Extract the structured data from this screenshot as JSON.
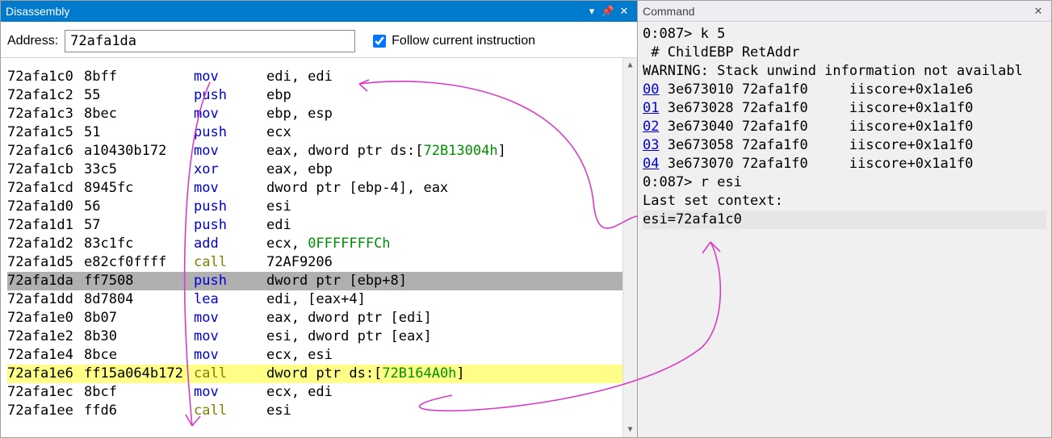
{
  "disasm": {
    "title": "Disassembly",
    "address_label": "Address:",
    "address_value": "72afa1da",
    "follow_label": "Follow current instruction",
    "follow_checked": true,
    "current_index": 8,
    "highlight_index": 17,
    "rows": [
      {
        "addr": "",
        "bytes": "",
        "mn": "",
        "mncls": "blue",
        "ops": "",
        "partial_top": true
      },
      {
        "addr": "72afa1c0",
        "bytes": "8bff",
        "mn": "mov",
        "mncls": "blue",
        "ops": "edi, edi"
      },
      {
        "addr": "72afa1c2",
        "bytes": "55",
        "mn": "push",
        "mncls": "blue",
        "ops": "ebp"
      },
      {
        "addr": "72afa1c3",
        "bytes": "8bec",
        "mn": "mov",
        "mncls": "blue",
        "ops": "ebp, esp"
      },
      {
        "addr": "72afa1c5",
        "bytes": "51",
        "mn": "push",
        "mncls": "blue",
        "ops": "ecx"
      },
      {
        "addr": "72afa1c6",
        "bytes": "a10430b172",
        "mn": "mov",
        "mncls": "blue",
        "ops": "eax, dword ptr ds:[",
        "lit": "72B13004h",
        "ops2": "]"
      },
      {
        "addr": "72afa1cb",
        "bytes": "33c5",
        "mn": "xor",
        "mncls": "blue",
        "ops": "eax, ebp"
      },
      {
        "addr": "72afa1cd",
        "bytes": "8945fc",
        "mn": "mov",
        "mncls": "blue",
        "ops": "dword ptr [ebp-4], eax"
      },
      {
        "addr": "72afa1d0",
        "bytes": "56",
        "mn": "push",
        "mncls": "blue",
        "ops": "esi"
      },
      {
        "addr": "72afa1d1",
        "bytes": "57",
        "mn": "push",
        "mncls": "blue",
        "ops": "edi"
      },
      {
        "addr": "72afa1d2",
        "bytes": "83c1fc",
        "mn": "add",
        "mncls": "blue",
        "ops": "ecx, ",
        "lit": "0FFFFFFFCh"
      },
      {
        "addr": "72afa1d5",
        "bytes": "e82cf0ffff",
        "mn": "call",
        "mncls": "olive",
        "ops": "72AF9206"
      },
      {
        "addr": "72afa1da",
        "bytes": "ff7508",
        "mn": "push",
        "mncls": "blue",
        "ops": "dword ptr [ebp+8]"
      },
      {
        "addr": "72afa1dd",
        "bytes": "8d7804",
        "mn": "lea",
        "mncls": "blue",
        "ops": "edi, [eax+4]"
      },
      {
        "addr": "72afa1e0",
        "bytes": "8b07",
        "mn": "mov",
        "mncls": "blue",
        "ops": "eax, dword ptr [edi]"
      },
      {
        "addr": "72afa1e2",
        "bytes": "8b30",
        "mn": "mov",
        "mncls": "blue",
        "ops": "esi, dword ptr [eax]"
      },
      {
        "addr": "72afa1e4",
        "bytes": "8bce",
        "mn": "mov",
        "mncls": "blue",
        "ops": "ecx, esi"
      },
      {
        "addr": "72afa1e6",
        "bytes": "ff15a064b172",
        "mn": "call",
        "mncls": "olive",
        "ops": "dword ptr ds:[",
        "lit": "72B164A0h",
        "ops2": "]"
      },
      {
        "addr": "72afa1ec",
        "bytes": "8bcf",
        "mn": "mov",
        "mncls": "blue",
        "ops": "ecx, edi"
      },
      {
        "addr": "72afa1ee",
        "bytes": "ffd6",
        "mn": "call",
        "mncls": "olive",
        "ops": "esi"
      }
    ]
  },
  "command": {
    "title": "Command",
    "lines": [
      {
        "t": "prompt",
        "text": "0:087> k 5"
      },
      {
        "t": "plain",
        "text": " # ChildEBP RetAddr"
      },
      {
        "t": "plain",
        "text": "WARNING: Stack unwind information not availabl"
      },
      {
        "t": "frame",
        "link": "00",
        "rest": " 3e673010 72afa1f0     iiscore+0x1a1e6"
      },
      {
        "t": "frame",
        "link": "01",
        "rest": " 3e673028 72afa1f0     iiscore+0x1a1f0"
      },
      {
        "t": "frame",
        "link": "02",
        "rest": " 3e673040 72afa1f0     iiscore+0x1a1f0"
      },
      {
        "t": "frame",
        "link": "03",
        "rest": " 3e673058 72afa1f0     iiscore+0x1a1f0"
      },
      {
        "t": "frame",
        "link": "04",
        "rest": " 3e673070 72afa1f0     iiscore+0x1a1f0"
      },
      {
        "t": "prompt",
        "text": "0:087> r esi"
      },
      {
        "t": "plain",
        "text": "Last set context:"
      },
      {
        "t": "plain",
        "text": "esi=72afa1c0",
        "last": true
      }
    ]
  }
}
